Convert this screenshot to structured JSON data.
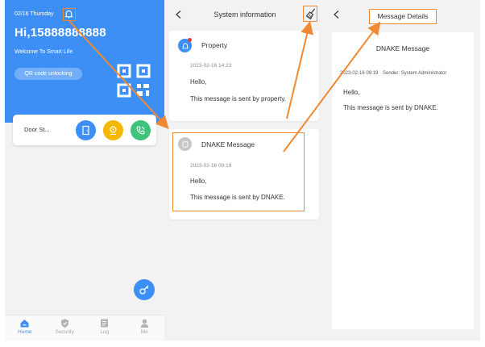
{
  "colors": {
    "primary": "#3d8ff5",
    "annotation": "#f08a32",
    "yellow": "#f5b800"
  },
  "home": {
    "date": "02/16 Thursday",
    "greeting": "Hi,15888888888",
    "welcome": "Welcome To Smart Life",
    "qr_button": "QR code unlocking",
    "door_label": "Door St...",
    "nav": [
      {
        "label": "Home",
        "icon": "home-icon",
        "active": true
      },
      {
        "label": "Security",
        "icon": "shield-icon",
        "active": false
      },
      {
        "label": "Log",
        "icon": "log-icon",
        "active": false
      },
      {
        "label": "Me",
        "icon": "person-icon",
        "active": false
      }
    ]
  },
  "system_info": {
    "title": "System information",
    "messages": [
      {
        "sender": "Property",
        "time": "2023-02-16 14:23",
        "greeting": "Hello,",
        "body": "This message is sent by property.",
        "unread": true
      },
      {
        "sender": "DNAKE Message",
        "time": "2023-02-16 09:19",
        "greeting": "Hello,",
        "body": "This message is sent by DNAKE.",
        "unread": false
      }
    ]
  },
  "message_details": {
    "title": "Message Details",
    "subject": "DNAKE Message",
    "time": "2023-02-16 09:19",
    "sender": "Sender: System Administrator",
    "greeting": "Hello,",
    "body": "This message is sent by DNAKE."
  }
}
